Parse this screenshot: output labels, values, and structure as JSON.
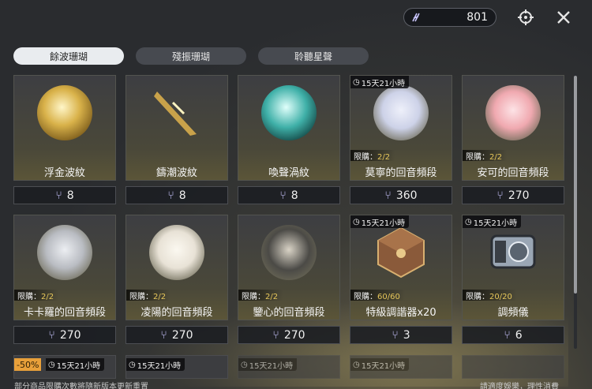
{
  "currency": {
    "value": "801",
    "icon": "tuning-fork-icon"
  },
  "top_actions": {
    "target_icon": "target-icon",
    "close_icon": "close-icon"
  },
  "tabs": [
    {
      "label": "餘波珊瑚"
    },
    {
      "label": "殘振珊瑚"
    },
    {
      "label": "聆聽星聲"
    }
  ],
  "items": [
    {
      "name": "浮金波紋",
      "price": "8",
      "timer": "",
      "limit_label": "",
      "limit_value": "",
      "art": "gold-sphere-icon",
      "color": "#d8b04a"
    },
    {
      "name": "鑄潮波紋",
      "price": "8",
      "timer": "",
      "limit_label": "",
      "limit_value": "",
      "art": "golden-blade-icon",
      "color": "#c9a24a"
    },
    {
      "name": "喚聲渦紋",
      "price": "8",
      "timer": "",
      "limit_label": "",
      "limit_value": "",
      "art": "teal-sphere-icon",
      "color": "#3fb0a8"
    },
    {
      "name": "莫寧的回音頻段",
      "price": "360",
      "timer": "15天21小時",
      "limit_label": "限購：",
      "limit_value": "2/2",
      "art": "character-portrait-icon",
      "color": "#cdd2e8"
    },
    {
      "name": "安可的回音頻段",
      "price": "270",
      "timer": "",
      "limit_label": "限購：",
      "limit_value": "2/2",
      "art": "character-portrait-icon",
      "color": "#f0a9b0"
    },
    {
      "name": "卡卡羅的回音頻段",
      "price": "270",
      "timer": "",
      "limit_label": "限購：",
      "limit_value": "2/2",
      "art": "character-portrait-icon",
      "color": "#b9bcc2"
    },
    {
      "name": "凌陽的回音頻段",
      "price": "270",
      "timer": "",
      "limit_label": "限購：",
      "limit_value": "2/2",
      "art": "character-portrait-icon",
      "color": "#e8e2d6"
    },
    {
      "name": "鑒心的回音頻段",
      "price": "270",
      "timer": "",
      "limit_label": "限購：",
      "limit_value": "2/2",
      "art": "character-portrait-icon",
      "color": "#4b4a46"
    },
    {
      "name": "特級調諧器x20",
      "price": "3",
      "timer": "15天21小時",
      "limit_label": "限購：",
      "limit_value": "60/60",
      "art": "tuner-cube-icon",
      "color": "#8a5a3a"
    },
    {
      "name": "調頻儀",
      "price": "6",
      "timer": "15天21小時",
      "limit_label": "限購：",
      "limit_value": "20/20",
      "art": "frequency-device-icon",
      "color": "#9aa6b4"
    }
  ],
  "row3": [
    {
      "discount": "-50%",
      "timer": "15天21小時"
    },
    {
      "discount": "",
      "timer": "15天21小時"
    },
    {
      "discount": "",
      "timer": "15天21小時"
    },
    {
      "discount": "",
      "timer": "15天21小時"
    },
    {
      "discount": "",
      "timer": ""
    }
  ],
  "footer": {
    "left": "部分商品限購次數將隨新版本更新重置",
    "right": "請適度娛樂，理性消費"
  }
}
